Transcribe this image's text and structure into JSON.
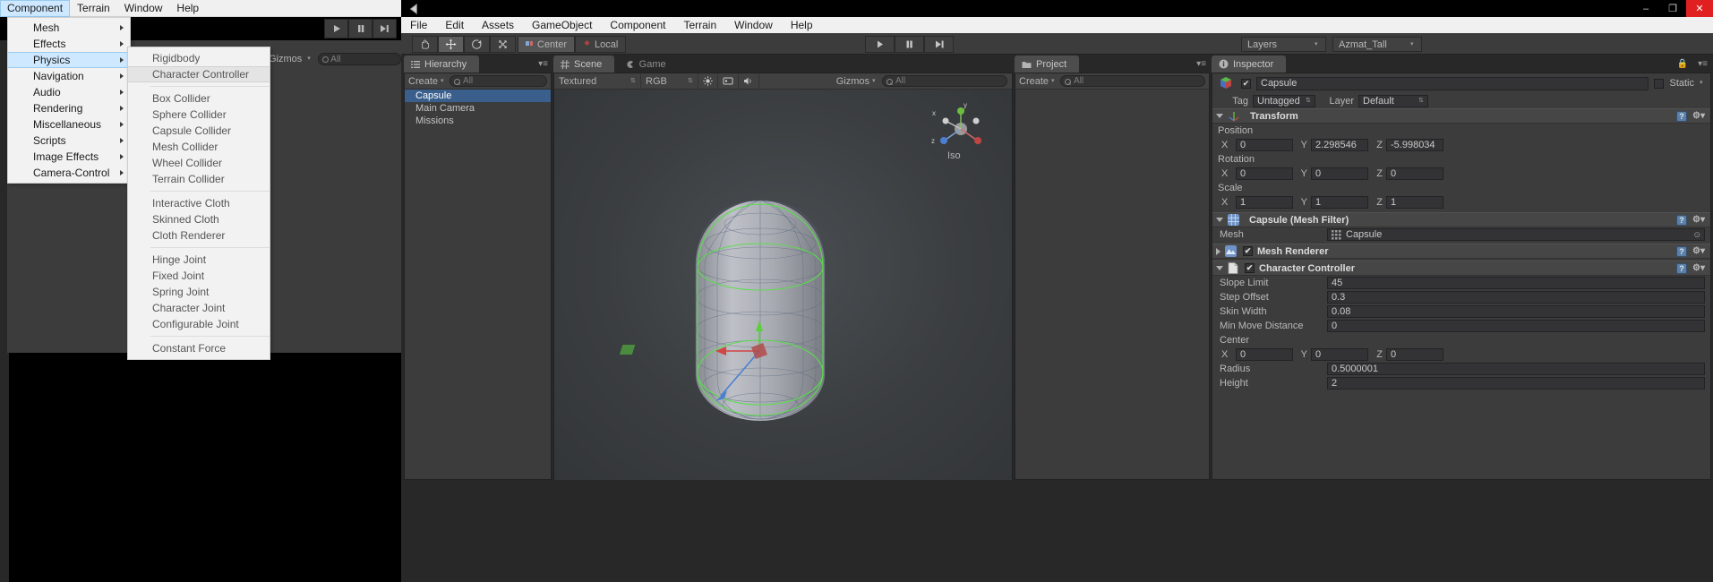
{
  "background_window": {
    "menubar": [
      {
        "label": "Component",
        "active": true
      },
      {
        "label": "Terrain",
        "active": false
      },
      {
        "label": "Window",
        "active": false
      },
      {
        "label": "Help",
        "active": false
      }
    ],
    "gizmos_label": "Gizmos",
    "search_placeholder": "All",
    "playback": [
      "play-icon",
      "pause-icon",
      "step-icon"
    ]
  },
  "component_menu": {
    "items": [
      {
        "label": "Mesh",
        "submenu": true,
        "highlighted": false
      },
      {
        "label": "Effects",
        "submenu": true,
        "highlighted": false
      },
      {
        "label": "Physics",
        "submenu": true,
        "highlighted": true
      },
      {
        "label": "Navigation",
        "submenu": true,
        "highlighted": false
      },
      {
        "label": "Audio",
        "submenu": true,
        "highlighted": false
      },
      {
        "label": "Rendering",
        "submenu": true,
        "highlighted": false
      },
      {
        "label": "Miscellaneous",
        "submenu": true,
        "highlighted": false
      },
      {
        "label": "Scripts",
        "submenu": true,
        "highlighted": false
      },
      {
        "label": "Image Effects",
        "submenu": true,
        "highlighted": false
      },
      {
        "label": "Camera-Control",
        "submenu": true,
        "highlighted": false
      }
    ]
  },
  "physics_submenu": {
    "groups": [
      [
        {
          "label": "Rigidbody",
          "highlighted": false
        },
        {
          "label": "Character Controller",
          "highlighted": true
        }
      ],
      [
        {
          "label": "Box Collider",
          "highlighted": false
        },
        {
          "label": "Sphere Collider",
          "highlighted": false
        },
        {
          "label": "Capsule Collider",
          "highlighted": false
        },
        {
          "label": "Mesh Collider",
          "highlighted": false
        },
        {
          "label": "Wheel Collider",
          "highlighted": false
        },
        {
          "label": "Terrain Collider",
          "highlighted": false
        }
      ],
      [
        {
          "label": "Interactive Cloth",
          "highlighted": false
        },
        {
          "label": "Skinned Cloth",
          "highlighted": false
        },
        {
          "label": "Cloth Renderer",
          "highlighted": false
        }
      ],
      [
        {
          "label": "Hinge Joint",
          "highlighted": false
        },
        {
          "label": "Fixed Joint",
          "highlighted": false
        },
        {
          "label": "Spring Joint",
          "highlighted": false
        },
        {
          "label": "Character Joint",
          "highlighted": false
        },
        {
          "label": "Configurable Joint",
          "highlighted": false
        }
      ],
      [
        {
          "label": "Constant Force",
          "highlighted": false
        }
      ]
    ]
  },
  "unity": {
    "menubar": [
      "File",
      "Edit",
      "Assets",
      "GameObject",
      "Component",
      "Terrain",
      "Window",
      "Help"
    ],
    "window_controls": {
      "minimize": "–",
      "maximize": "❐",
      "close": "✕"
    },
    "toolbar": {
      "tools": [
        "hand-icon",
        "move-icon",
        "rotate-icon",
        "scale-icon"
      ],
      "selected_tool_index": 1,
      "pivot_mode": "Center",
      "pivot_rotation": "Local",
      "playback": [
        "play-icon",
        "pause-icon",
        "step-icon"
      ],
      "layers_label": "Layers",
      "layout_label": "Azmat_Tall"
    },
    "hierarchy": {
      "tab": "Hierarchy",
      "create_label": "Create",
      "search_placeholder": "All",
      "items": [
        {
          "label": "Capsule",
          "selected": true
        },
        {
          "label": "Main Camera",
          "selected": false
        },
        {
          "label": "Missions",
          "selected": false
        }
      ]
    },
    "scene": {
      "tab": "Scene",
      "game_tab": "Game",
      "draw_mode": "Textured",
      "render_mode": "RGB",
      "lighting_icon": "sun-icon",
      "fx_icon": "fx-icon",
      "audio_icon": "speaker-icon",
      "gizmos_label": "Gizmos",
      "search_placeholder": "All",
      "view_label": "Iso",
      "axis_labels": {
        "x": "x",
        "y": "y",
        "z": "z"
      }
    },
    "project": {
      "tab": "Project",
      "create_label": "Create",
      "search_placeholder": "All"
    },
    "inspector": {
      "tab": "Inspector",
      "lock_icon": "lock-icon",
      "menu_icon": "hamburger-icon",
      "object_name": "Capsule",
      "object_enabled": true,
      "static_label": "Static",
      "static_checked": false,
      "tag_label": "Tag",
      "tag_value": "Untagged",
      "layer_label": "Layer",
      "layer_value": "Default",
      "components": [
        {
          "name": "Transform",
          "icon": "transform-icon",
          "expanded": true,
          "has_checkbox": false,
          "vectors": [
            {
              "label": "Position",
              "x": "0",
              "y": "2.298546",
              "z": "-5.998034"
            },
            {
              "label": "Rotation",
              "x": "0",
              "y": "0",
              "z": "0"
            },
            {
              "label": "Scale",
              "x": "1",
              "y": "1",
              "z": "1"
            }
          ]
        },
        {
          "name": "Capsule (Mesh Filter)",
          "icon": "mesh-filter-icon",
          "expanded": true,
          "has_checkbox": false,
          "fields": [
            {
              "label": "Mesh",
              "value": "Capsule",
              "type": "object"
            }
          ]
        },
        {
          "name": "Mesh Renderer",
          "icon": "mesh-renderer-icon",
          "expanded": false,
          "has_checkbox": true,
          "checked": true,
          "fields": []
        },
        {
          "name": "Character Controller",
          "icon": "script-icon",
          "expanded": true,
          "has_checkbox": true,
          "checked": true,
          "fields": [
            {
              "label": "Slope Limit",
              "value": "45",
              "type": "text"
            },
            {
              "label": "Step Offset",
              "value": "0.3",
              "type": "text"
            },
            {
              "label": "Skin Width",
              "value": "0.08",
              "type": "text"
            },
            {
              "label": "Min Move Distance",
              "value": "0",
              "type": "text"
            }
          ],
          "vectors": [
            {
              "label": "Center",
              "x": "0",
              "y": "0",
              "z": "0"
            }
          ],
          "fields_after": [
            {
              "label": "Radius",
              "value": "0.5000001",
              "type": "text"
            },
            {
              "label": "Height",
              "value": "2",
              "type": "text"
            }
          ]
        }
      ]
    }
  },
  "colors": {
    "selection_blue": "#3a5f8c",
    "menu_highlight": "#cde8ff",
    "panel_dark": "#3c3c3c",
    "close_red": "#e02020",
    "axis_x": "#d14545",
    "axis_y": "#6abf3f",
    "axis_z": "#4a7fd1"
  }
}
